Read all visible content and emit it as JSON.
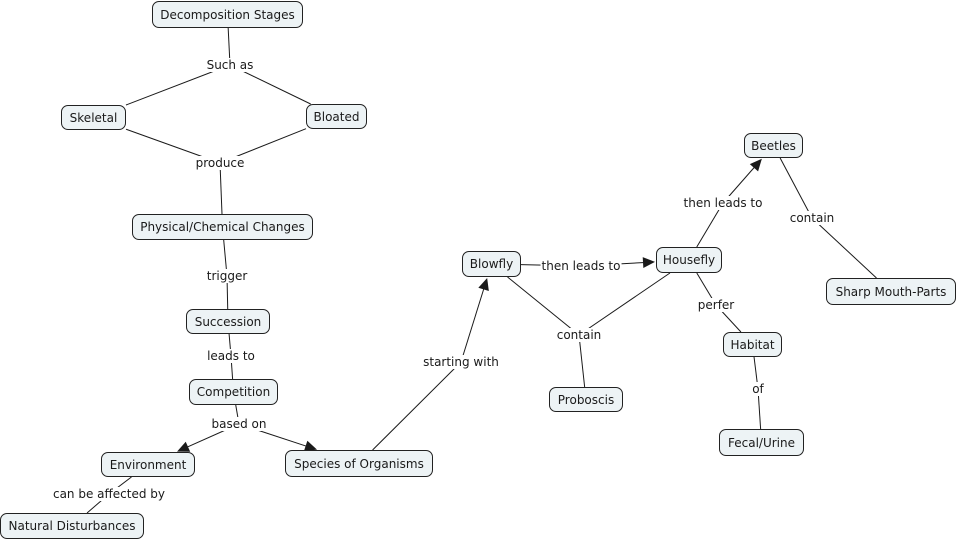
{
  "diagram": {
    "type": "concept-map",
    "colors": {
      "node_fill": "#edf3f5",
      "node_border": "#222222",
      "line": "#1a1a1a",
      "text": "#1a1a1a"
    },
    "nodes": [
      {
        "id": "decomposition",
        "label": "Decomposition Stages"
      },
      {
        "id": "skeletal",
        "label": "Skeletal"
      },
      {
        "id": "bloated",
        "label": "Bloated"
      },
      {
        "id": "physchem",
        "label": "Physical/Chemical Changes"
      },
      {
        "id": "succession",
        "label": "Succession"
      },
      {
        "id": "competition",
        "label": "Competition"
      },
      {
        "id": "environment",
        "label": "Environment"
      },
      {
        "id": "natural",
        "label": "Natural Disturbances"
      },
      {
        "id": "species",
        "label": "Species of Organisms"
      },
      {
        "id": "blowfly",
        "label": "Blowfly"
      },
      {
        "id": "housefly",
        "label": "Housefly"
      },
      {
        "id": "beetles",
        "label": "Beetles"
      },
      {
        "id": "sharp",
        "label": "Sharp Mouth-Parts"
      },
      {
        "id": "proboscis",
        "label": "Proboscis"
      },
      {
        "id": "habitat",
        "label": "Habitat"
      },
      {
        "id": "fecal",
        "label": "Fecal/Urine"
      }
    ],
    "links": [
      {
        "id": "suchas",
        "label": "Such as",
        "from": [
          "decomposition"
        ],
        "to": [
          "skeletal",
          "bloated"
        ],
        "arrows": false
      },
      {
        "id": "produce",
        "label": "produce",
        "from": [
          "skeletal",
          "bloated"
        ],
        "to": [
          "physchem"
        ],
        "arrows": false
      },
      {
        "id": "trigger",
        "label": "trigger",
        "from": [
          "physchem"
        ],
        "to": [
          "succession"
        ],
        "arrows": false
      },
      {
        "id": "leadsto",
        "label": "leads to",
        "from": [
          "succession"
        ],
        "to": [
          "competition"
        ],
        "arrows": false
      },
      {
        "id": "basedon",
        "label": "based on",
        "from": [
          "competition"
        ],
        "to": [
          "environment",
          "species"
        ],
        "arrows": true
      },
      {
        "id": "affected",
        "label": "can be affected by",
        "from": [
          "environment"
        ],
        "to": [
          "natural"
        ],
        "arrows": false
      },
      {
        "id": "starting",
        "label": "starting with",
        "from": [
          "species"
        ],
        "to": [
          "blowfly"
        ],
        "arrows": true
      },
      {
        "id": "thenleads1",
        "label": "then leads to",
        "from": [
          "blowfly"
        ],
        "to": [
          "housefly"
        ],
        "arrows": true
      },
      {
        "id": "contain1",
        "label": "contain",
        "from": [
          "blowfly",
          "housefly"
        ],
        "to": [
          "proboscis"
        ],
        "arrows": false
      },
      {
        "id": "thenleads2",
        "label": "then leads to",
        "from": [
          "housefly"
        ],
        "to": [
          "beetles"
        ],
        "arrows": true
      },
      {
        "id": "contain2",
        "label": "contain",
        "from": [
          "beetles"
        ],
        "to": [
          "sharp"
        ],
        "arrows": false
      },
      {
        "id": "perfer",
        "label": "perfer",
        "from": [
          "housefly"
        ],
        "to": [
          "habitat"
        ],
        "arrows": false
      },
      {
        "id": "of",
        "label": "of",
        "from": [
          "habitat"
        ],
        "to": [
          "fecal"
        ],
        "arrows": false
      }
    ]
  }
}
